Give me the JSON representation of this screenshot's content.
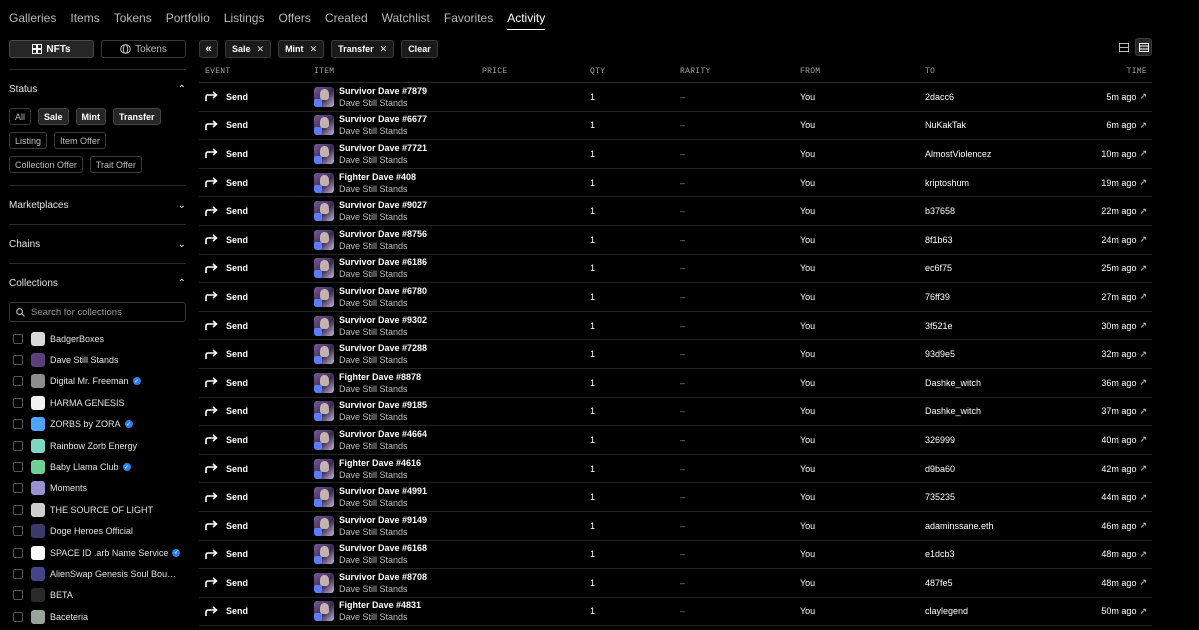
{
  "nav": {
    "tabs": [
      "Galleries",
      "Items",
      "Tokens",
      "Portfolio",
      "Listings",
      "Offers",
      "Created",
      "Watchlist",
      "Favorites",
      "Activity"
    ],
    "active": "Activity"
  },
  "sidebar": {
    "toggle": {
      "nfts": "NFTs",
      "tokens": "Tokens"
    },
    "status": {
      "title": "Status",
      "chips": [
        {
          "label": "All",
          "active": false
        },
        {
          "label": "Sale",
          "active": true
        },
        {
          "label": "Mint",
          "active": true
        },
        {
          "label": "Transfer",
          "active": true
        },
        {
          "label": "Listing",
          "active": false
        },
        {
          "label": "Item Offer",
          "active": false
        },
        {
          "label": "Collection Offer",
          "active": false
        },
        {
          "label": "Trait Offer",
          "active": false
        }
      ]
    },
    "marketplaces": {
      "title": "Marketplaces"
    },
    "chains": {
      "title": "Chains"
    },
    "collections": {
      "title": "Collections",
      "search_placeholder": "Search for collections",
      "items": [
        {
          "name": "BadgerBoxes",
          "verified": false,
          "color": "#d9d9d9"
        },
        {
          "name": "Dave Still Stands",
          "verified": false,
          "color": "#5b3f7a"
        },
        {
          "name": "Digital Mr. Freeman",
          "verified": true,
          "color": "#8c8c8c"
        },
        {
          "name": "HARMA GENESIS",
          "verified": false,
          "color": "#f2f2f2"
        },
        {
          "name": "ZORBS by ZORA",
          "verified": true,
          "color": "#4fa3ff"
        },
        {
          "name": "Rainbow Zorb Energy",
          "verified": false,
          "color": "#7fd6c2"
        },
        {
          "name": "Baby Llama Club",
          "verified": true,
          "color": "#6fcf97"
        },
        {
          "name": "Moments",
          "verified": false,
          "color": "#9a8fd1"
        },
        {
          "name": "THE SOURCE OF LIGHT",
          "verified": false,
          "color": "#cfcfcf"
        },
        {
          "name": "Doge Heroes Official",
          "verified": false,
          "color": "#3b3b6b"
        },
        {
          "name": "SPACE ID .arb Name Service",
          "verified": true,
          "color": "#ffffff"
        },
        {
          "name": "AlienSwap Genesis Soul Bound …",
          "verified": false,
          "color": "#444488"
        },
        {
          "name": "BETA",
          "verified": false,
          "color": "#2a2a2a"
        },
        {
          "name": "Baceteria",
          "verified": false,
          "color": "#9aa39a"
        }
      ]
    }
  },
  "filters": {
    "active": [
      "Sale",
      "Mint",
      "Transfer"
    ],
    "clear": "Clear"
  },
  "table": {
    "headers": {
      "event": "EVENT",
      "item": "ITEM",
      "price": "PRICE",
      "qty": "QTY",
      "rarity": "RARITY",
      "from": "FROM",
      "to": "TO",
      "time": "TIME"
    },
    "rows": [
      {
        "event": "Send",
        "name": "Survivor Dave #7879",
        "collection": "Dave Still Stands",
        "qty": "1",
        "rarity": "–",
        "from": "You",
        "to": "2dacc6",
        "time": "5m ago"
      },
      {
        "event": "Send",
        "name": "Survivor Dave #6677",
        "collection": "Dave Still Stands",
        "qty": "1",
        "rarity": "–",
        "from": "You",
        "to": "NuKakTak",
        "time": "6m ago"
      },
      {
        "event": "Send",
        "name": "Survivor Dave #7721",
        "collection": "Dave Still Stands",
        "qty": "1",
        "rarity": "–",
        "from": "You",
        "to": "AlmostViolencez",
        "time": "10m ago"
      },
      {
        "event": "Send",
        "name": "Fighter Dave #408",
        "collection": "Dave Still Stands",
        "qty": "1",
        "rarity": "–",
        "from": "You",
        "to": "kriptoshum",
        "time": "19m ago"
      },
      {
        "event": "Send",
        "name": "Survivor Dave #9027",
        "collection": "Dave Still Stands",
        "qty": "1",
        "rarity": "–",
        "from": "You",
        "to": "b37658",
        "time": "22m ago"
      },
      {
        "event": "Send",
        "name": "Survivor Dave #8756",
        "collection": "Dave Still Stands",
        "qty": "1",
        "rarity": "–",
        "from": "You",
        "to": "8f1b63",
        "time": "24m ago"
      },
      {
        "event": "Send",
        "name": "Survivor Dave #6186",
        "collection": "Dave Still Stands",
        "qty": "1",
        "rarity": "–",
        "from": "You",
        "to": "ec6f75",
        "time": "25m ago"
      },
      {
        "event": "Send",
        "name": "Survivor Dave #6780",
        "collection": "Dave Still Stands",
        "qty": "1",
        "rarity": "–",
        "from": "You",
        "to": "76ff39",
        "time": "27m ago"
      },
      {
        "event": "Send",
        "name": "Survivor Dave #9302",
        "collection": "Dave Still Stands",
        "qty": "1",
        "rarity": "–",
        "from": "You",
        "to": "3f521e",
        "time": "30m ago"
      },
      {
        "event": "Send",
        "name": "Survivor Dave #7288",
        "collection": "Dave Still Stands",
        "qty": "1",
        "rarity": "–",
        "from": "You",
        "to": "93d9e5",
        "time": "32m ago"
      },
      {
        "event": "Send",
        "name": "Fighter Dave #8878",
        "collection": "Dave Still Stands",
        "qty": "1",
        "rarity": "–",
        "from": "You",
        "to": "Dashke_witch",
        "time": "36m ago"
      },
      {
        "event": "Send",
        "name": "Survivor Dave #9185",
        "collection": "Dave Still Stands",
        "qty": "1",
        "rarity": "–",
        "from": "You",
        "to": "Dashke_witch",
        "time": "37m ago"
      },
      {
        "event": "Send",
        "name": "Survivor Dave #4664",
        "collection": "Dave Still Stands",
        "qty": "1",
        "rarity": "–",
        "from": "You",
        "to": "326999",
        "time": "40m ago"
      },
      {
        "event": "Send",
        "name": "Fighter Dave #4616",
        "collection": "Dave Still Stands",
        "qty": "1",
        "rarity": "–",
        "from": "You",
        "to": "d9ba60",
        "time": "42m ago"
      },
      {
        "event": "Send",
        "name": "Survivor Dave #4991",
        "collection": "Dave Still Stands",
        "qty": "1",
        "rarity": "–",
        "from": "You",
        "to": "735235",
        "time": "44m ago"
      },
      {
        "event": "Send",
        "name": "Survivor Dave #9149",
        "collection": "Dave Still Stands",
        "qty": "1",
        "rarity": "–",
        "from": "You",
        "to": "adaminssane.eth",
        "time": "46m ago"
      },
      {
        "event": "Send",
        "name": "Survivor Dave #6168",
        "collection": "Dave Still Stands",
        "qty": "1",
        "rarity": "–",
        "from": "You",
        "to": "e1dcb3",
        "time": "48m ago"
      },
      {
        "event": "Send",
        "name": "Survivor Dave #8708",
        "collection": "Dave Still Stands",
        "qty": "1",
        "rarity": "–",
        "from": "You",
        "to": "487fe5",
        "time": "48m ago"
      },
      {
        "event": "Send",
        "name": "Fighter Dave #4831",
        "collection": "Dave Still Stands",
        "qty": "1",
        "rarity": "–",
        "from": "You",
        "to": "claylegend",
        "time": "50m ago"
      }
    ]
  }
}
